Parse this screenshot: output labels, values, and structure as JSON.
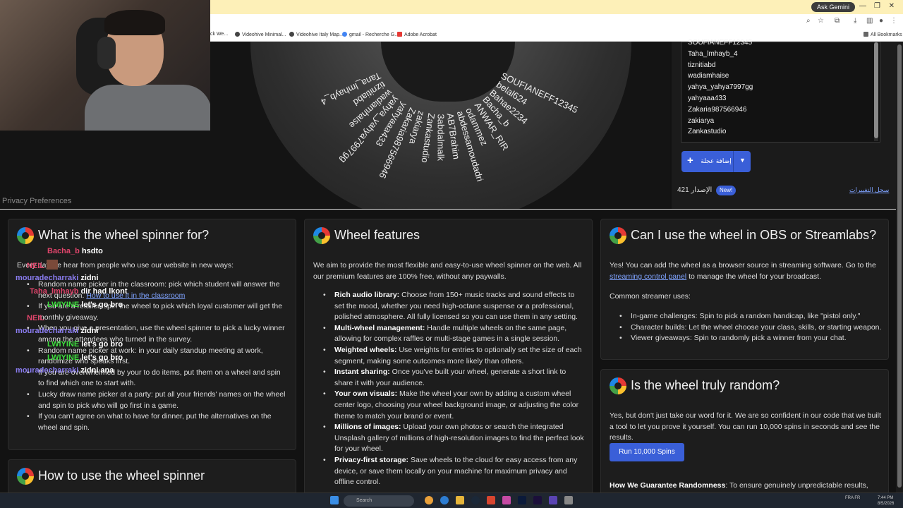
{
  "browser": {
    "ask_gemini": "Ask Gemini",
    "bookmarks": [
      {
        "label": "Videohive Minimal...",
        "color": "#333333"
      },
      {
        "label": "Videohive Italy Map...",
        "color": "#333333"
      },
      {
        "label": "gmail - Recherche G...",
        "color": "#4285f4"
      },
      {
        "label": "Adobe Acrobat",
        "color": "#e53935"
      }
    ],
    "all_bookmarks": "All Bookmarks"
  },
  "wheel_names": [
    "Tana_lmhayb_4",
    "tiznitiabd",
    "wadiamhaise",
    "yahya_yahya7997gg",
    "yahyaaa433",
    "Zakaria987566946",
    "zakiarya",
    "Zankastudio",
    "3abdalmalk",
    "AB7Brahim",
    "abdessamoudadri",
    "odammez",
    "ANWAR_RIR",
    "Bacha_b",
    "Bahae2234",
    "belal624",
    "SOUFIANEFF12345"
  ],
  "side_panel": {
    "entries": [
      "SOUFIANEFF12345",
      "Taha_lmhayb_4",
      "tiznitiabd",
      "wadiamhaise",
      "yahya_yahya7997gg",
      "yahyaaa433",
      "Zakaria987566946",
      "zakiarya",
      "Zankastudio"
    ],
    "add_button": "إضافة عجلة",
    "version": "421 الإصدار",
    "new_badge": "New!",
    "changelog": "سجل التغييرات"
  },
  "privacy": "Privacy Preferences",
  "cards": {
    "what": {
      "title": "What is the wheel spinner for?",
      "intro": "Every day we hear from people who use our website in new ways:",
      "items": [
        "Random name picker in the classroom: pick which student will answer the next question.",
        "If you are a retailer, spin the wheel to pick which loyal customer will get the monthly giveaway.",
        "When you give a presentation, use the wheel spinner to pick a lucky winner among the attendees who turned in the survey.",
        "Random name picker at work: in your daily standup meeting at work, randomize who speaks first.",
        "If you are overwhelmed by your to do items, put them on a wheel and spin to find which one to start with.",
        "Lucky draw name picker at a party: put all your friends' names on the wheel and spin to pick who will go first in a game.",
        "If you can't agree on what to have for dinner, put the alternatives on the wheel and spin."
      ],
      "link": "How to use it in the classroom"
    },
    "how": {
      "title": "How to use the wheel spinner"
    },
    "features": {
      "title": "Wheel features",
      "intro": "We aim to provide the most flexible and easy-to-use wheel spinner on the web. All our premium features are 100% free, without any paywalls.",
      "items": [
        {
          "b": "Rich audio library:",
          "t": " Choose from 150+ music tracks and sound effects to set the mood, whether you need high-octane suspense or a professional, polished atmosphere. All fully licensed so you can use them in any setting."
        },
        {
          "b": "Multi-wheel management:",
          "t": " Handle multiple wheels on the same page, allowing for complex raffles or multi-stage games in a single session."
        },
        {
          "b": "Weighted wheels:",
          "t": " Use weights for entries to optionally set the size of each segment, making some outcomes more likely than others."
        },
        {
          "b": "Instant sharing:",
          "t": " Once you've built your wheel, generate a short link to share it with your audience."
        },
        {
          "b": "Your own visuals:",
          "t": " Make the wheel your own by adding a custom wheel center logo, choosing your wheel background image, or adjusting the color theme to match your brand or event."
        },
        {
          "b": "Millions of images:",
          "t": " Upload your own photos or search the integrated Unsplash gallery of millions of high-resolution images to find the perfect look for your wheel."
        },
        {
          "b": "Privacy-first storage:",
          "t": " Save wheels to the cloud for easy access from any device, or save them locally on your machine for maximum privacy and offline control."
        }
      ]
    },
    "obs": {
      "title": "Can I use the wheel in OBS or Streamlabs?",
      "p1a": "Yes! You can add the wheel as a browser source in streaming software. Go to the ",
      "p1link": "streaming control panel",
      "p1b": " to manage the wheel for your broadcast.",
      "p2": "Common streamer uses:",
      "items": [
        "In-game challenges: Spin to pick a random handicap, like \"pistol only.\"",
        "Character builds: Let the wheel choose your class, skills, or starting weapon.",
        "Viewer giveaways: Spin to randomly pick a winner from your chat."
      ]
    },
    "random": {
      "title": "Is the wheel truly random?",
      "p1": "Yes, but don't just take our word for it. We are so confident in our code that we built a tool to let you prove it yourself. You can run 10,000 spins in seconds and see the results.",
      "button": "Run 10,000 Spins",
      "p2b": "How We Guarantee Randomness",
      "p2": ": To ensure genuinely unpredictable results, this"
    }
  },
  "chat": [
    {
      "user": "Bacha_b",
      "msg": "hsdto",
      "color": "#e0456b"
    },
    {
      "user": "NEIL",
      "msg": "",
      "color": "#e0456b"
    },
    {
      "user": "mouradecharraki",
      "msg": "zidni",
      "color": "#8a7cf0"
    },
    {
      "user": "Taha_lmhayb",
      "msg": "dir had lkont",
      "color": "#e0456b"
    },
    {
      "user": "LWIYINE",
      "msg": "let's go bro",
      "color": "#3ddc3d"
    },
    {
      "user": "NEIL",
      "msg": "",
      "color": "#e0456b"
    },
    {
      "user": "mouradecharraki",
      "msg": "zidni",
      "color": "#8a7cf0"
    },
    {
      "user": "LWIYINE",
      "msg": "let's go bro",
      "color": "#3ddc3d"
    },
    {
      "user": "LWIYINE",
      "msg": "let's go bro",
      "color": "#3ddc3d"
    },
    {
      "user": "mouradecharraki",
      "msg": "zidni ana",
      "color": "#8a7cf0"
    }
  ],
  "taskbar": {
    "search": "Search",
    "lang": "FRA FR",
    "time": "7:44 PM",
    "date": "8/5/2026"
  }
}
